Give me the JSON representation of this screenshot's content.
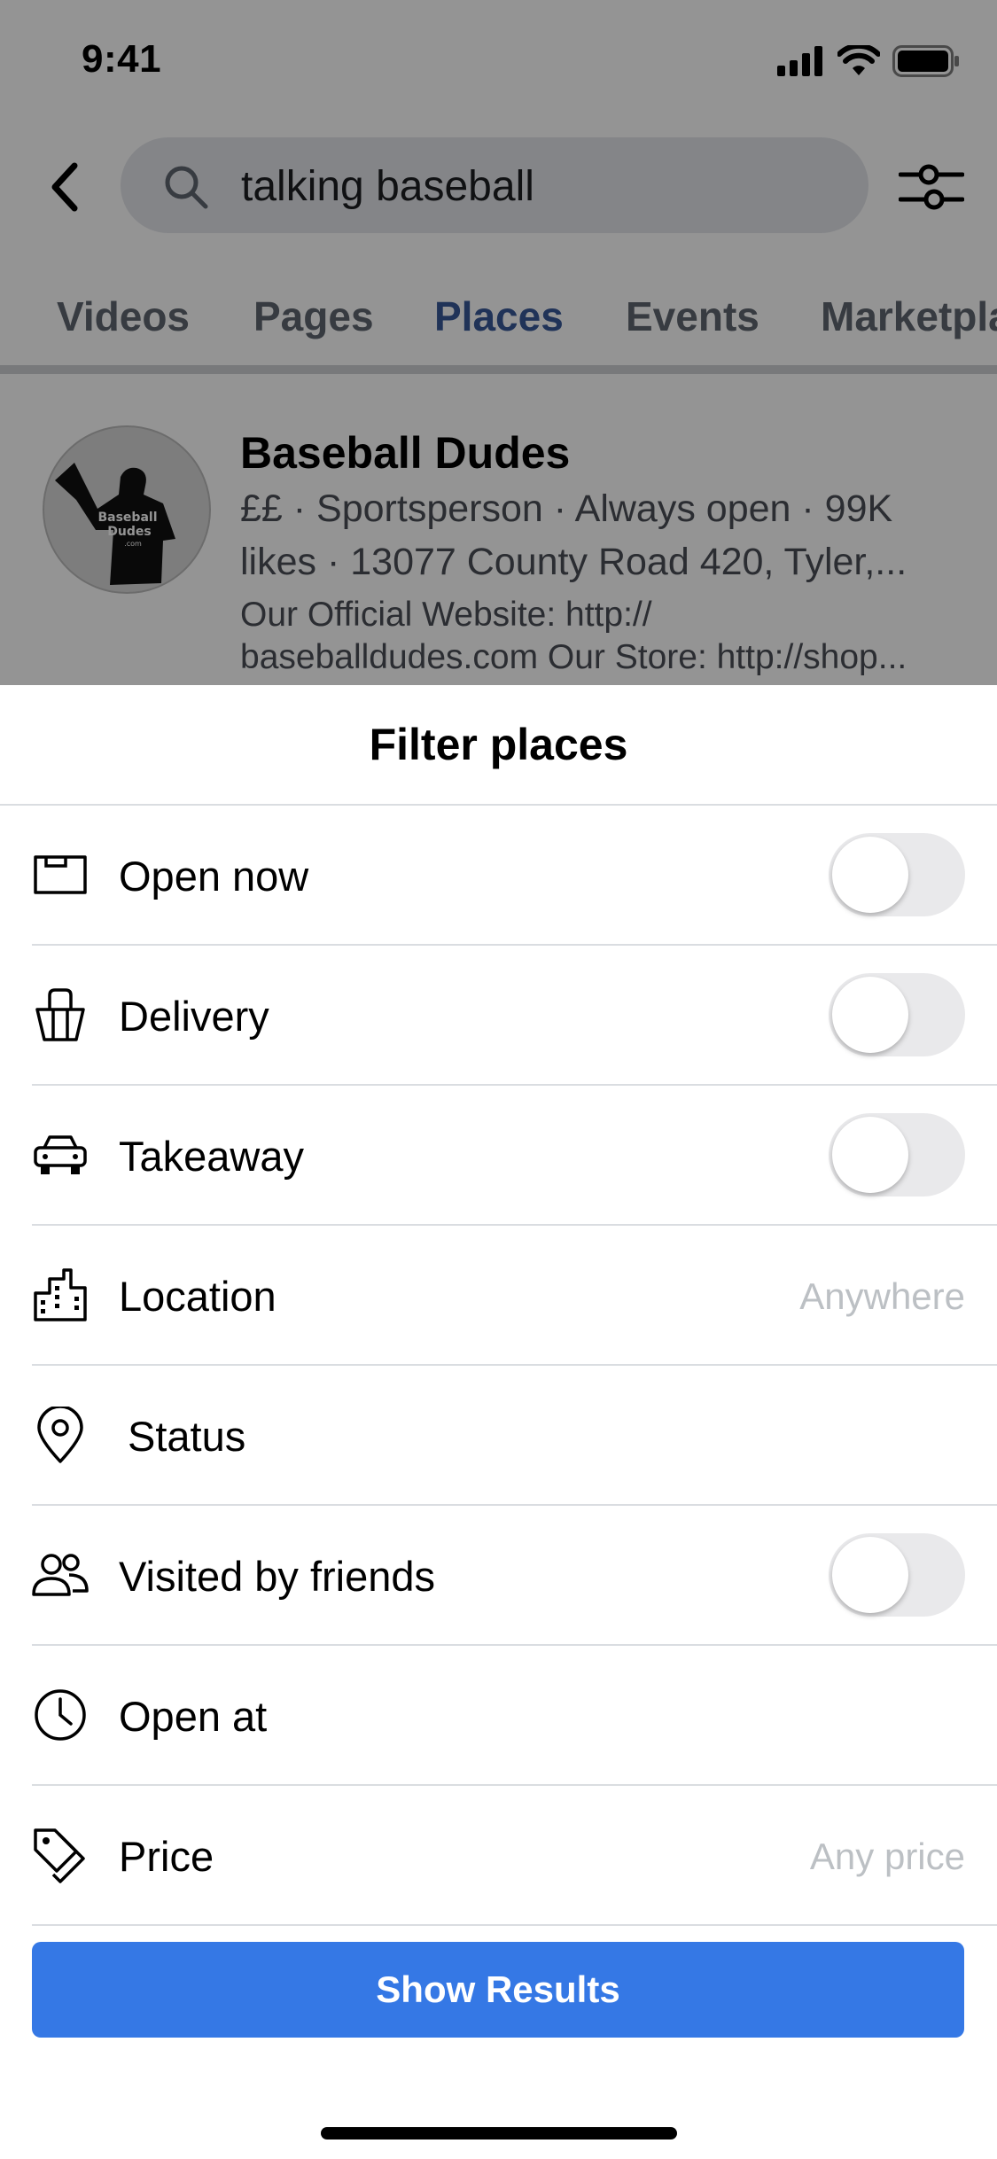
{
  "status_bar": {
    "time": "9:41"
  },
  "search": {
    "query": "talking baseball"
  },
  "tabs": [
    {
      "label": "Videos"
    },
    {
      "label": "Pages"
    },
    {
      "label": "Places",
      "active": true
    },
    {
      "label": "Events"
    },
    {
      "label": "Marketpla"
    }
  ],
  "result": {
    "title": "Baseball Dudes",
    "meta": "££ · Sportsperson · Always open · 99K likes · 13077 County Road 420, Tyler,...",
    "description": "Our Official Website: http:// baseballdudes.com Our Store: http://shop...",
    "logo_text_line1": "Baseball",
    "logo_text_line2": "Dudes",
    "logo_text_line3": ".com"
  },
  "sheet": {
    "title": "Filter places",
    "rows": [
      {
        "label": "Open now",
        "icon": "sign-icon",
        "control": "toggle",
        "on": false
      },
      {
        "label": "Delivery",
        "icon": "bag-icon",
        "control": "toggle",
        "on": false
      },
      {
        "label": "Takeaway",
        "icon": "car-icon",
        "control": "toggle",
        "on": false
      },
      {
        "label": "Location",
        "icon": "city-icon",
        "value": "Anywhere"
      },
      {
        "label": "Status",
        "icon": "pin-icon"
      },
      {
        "label": "Visited by friends",
        "icon": "friends-icon",
        "control": "toggle",
        "on": false
      },
      {
        "label": "Open at",
        "icon": "clock-icon"
      },
      {
        "label": "Price",
        "icon": "tag-icon",
        "value": "Any price"
      }
    ],
    "button_label": "Show Results"
  },
  "colors": {
    "accent": "#385898",
    "button": "#3578e5",
    "toggle_off": "#e9e9eb",
    "placeholder": "#bcc0c4"
  }
}
